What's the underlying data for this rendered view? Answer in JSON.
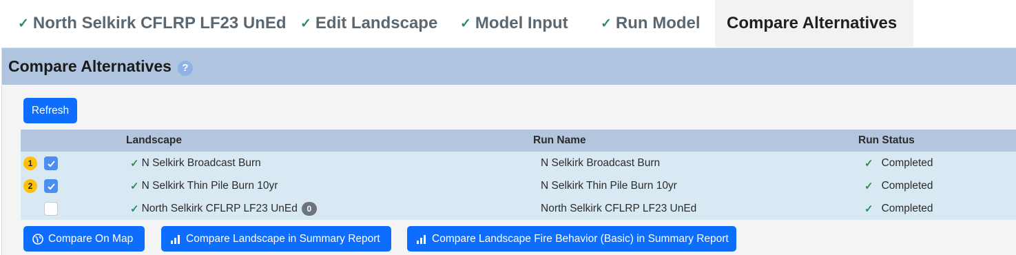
{
  "tabs": [
    {
      "label": "North Selkirk CFLRP LF23 UnEd",
      "done": true
    },
    {
      "label": "Edit Landscape",
      "done": true
    },
    {
      "label": "Model Input",
      "done": true
    },
    {
      "label": "Run Model",
      "done": true
    },
    {
      "label": "Compare Alternatives",
      "active": true
    }
  ],
  "panel": {
    "title": "Compare Alternatives",
    "help_icon": "?"
  },
  "refresh_label": "Refresh",
  "table": {
    "columns": [
      "Landscape",
      "Run Name",
      "Run Status"
    ],
    "rows": [
      {
        "order": "1",
        "checked": true,
        "landscape": "N Selkirk Broadcast Burn",
        "run_name": "N Selkirk Broadcast Burn",
        "status": "Completed"
      },
      {
        "order": "2",
        "checked": true,
        "landscape": "N Selkirk Thin Pile Burn 10yr",
        "run_name": "N Selkirk Thin Pile Burn 10yr",
        "status": "Completed"
      },
      {
        "order": "",
        "checked": false,
        "landscape": "North Selkirk CFLRP LF23 UnEd",
        "count": "0",
        "run_name": "North Selkirk CFLRP LF23 UnEd",
        "status": "Completed"
      }
    ]
  },
  "actions": {
    "compare_map": "Compare On Map",
    "compare_summary": "Compare Landscape in Summary Report",
    "compare_fire": "Compare Landscape Fire Behavior (Basic) in Summary Report"
  },
  "colors": {
    "primary": "#0d6efd",
    "success": "#2e8b57",
    "header": "#afc4de",
    "row_bg": "#d9e9f3",
    "badge": "#ffc107"
  }
}
